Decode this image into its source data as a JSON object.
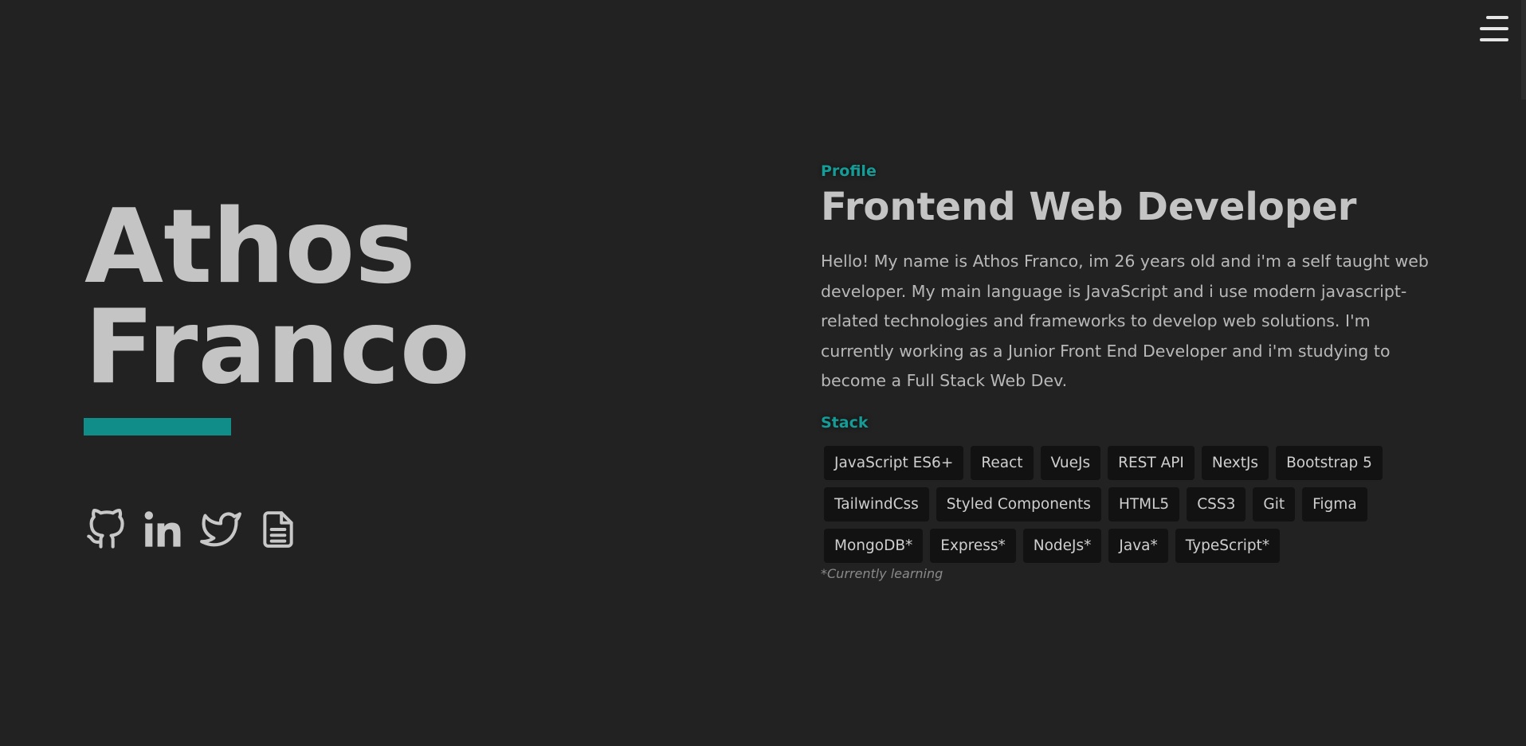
{
  "header": {
    "menu_icon": "hamburger-menu-icon"
  },
  "hero": {
    "first_name": "Athos",
    "last_name": "Franco",
    "accent_color": "#108d88"
  },
  "socials": [
    {
      "icon": "github-icon"
    },
    {
      "icon": "linkedin-icon"
    },
    {
      "icon": "twitter-icon"
    },
    {
      "icon": "resume-document-icon"
    }
  ],
  "profile": {
    "eyebrow": "Profile",
    "title": "Frontend Web Developer",
    "bio": "Hello! My name is Athos Franco, im 26 years old and i'm a self taught web developer. My main language is JavaScript and i use modern javascript-related technologies and frameworks to develop web solutions. I'm currently working as a Junior Front End Developer and i'm studying to become a Full Stack Web Dev."
  },
  "stack": {
    "label": "Stack",
    "tags": [
      "JavaScript ES6+",
      "React",
      "VueJs",
      "REST API",
      "NextJs",
      "Bootstrap 5",
      "TailwindCss",
      "Styled Components",
      "HTML5",
      "CSS3",
      "Git",
      "Figma",
      "MongoDB*",
      "Express*",
      "NodeJs*",
      "Java*",
      "TypeScript*"
    ],
    "note": "*Currently learning"
  }
}
